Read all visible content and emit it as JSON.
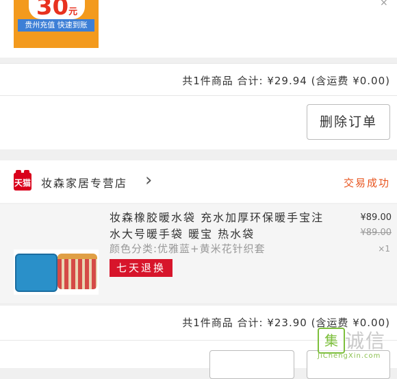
{
  "order1": {
    "promo_value": "30",
    "promo_unit": "元",
    "promo_strip": "贵州充值 快速到账",
    "close_mark": "×",
    "summary": "共1件商品 合计: ¥29.94 (含运费 ¥0.00)",
    "delete_button": "删除订单"
  },
  "order2": {
    "shop_logo": "天猫",
    "shop_name": "妆森家居专营店",
    "chevron": "›",
    "status": "交易成功",
    "product_title": "妆森橡胶暖水袋 充水加厚环保暖手宝注水大号暖手袋 暖宝 热水袋",
    "product_sku": "颜色分类:优雅蓝+黄米花针织套",
    "return_tag": "七天退换",
    "price_current": "¥89.00",
    "price_original": "¥89.00",
    "quantity": "×1",
    "summary": "共1件商品 合计: ¥23.90 (含运费 ¥0.00)"
  },
  "watermark": {
    "logo_char": "集",
    "cn_text": "诚信",
    "url": "JiChengXin.com"
  },
  "colors": {
    "accent_red": "#d7152b",
    "status_orange": "#e8541e",
    "promo_orange": "#f39a1d"
  }
}
